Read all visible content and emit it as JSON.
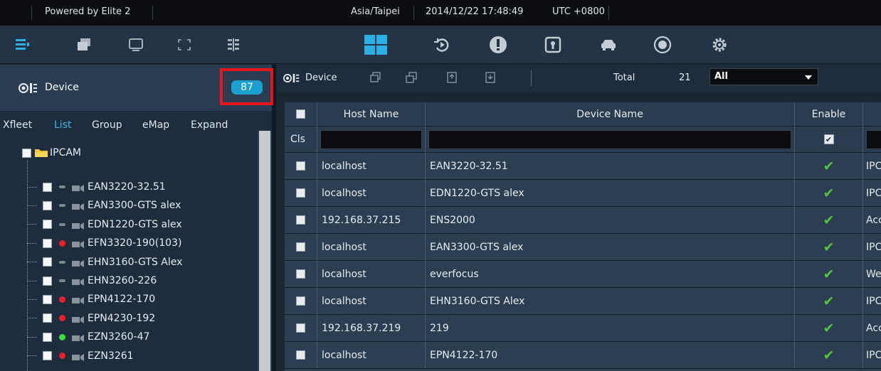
{
  "statusbar": {
    "powered_by": "Powered by Elite 2",
    "timezone": "Asia/Taipei",
    "datetime": "2014/12/22 17:48:49",
    "utc": "UTC +0800"
  },
  "toolbar": {
    "left_icons": [
      "list-panel-icon",
      "windows-icon",
      "monitor-icon",
      "fullscreen-icon",
      "grid-layout-icon"
    ],
    "main_icons": [
      "dashboard-icon",
      "playback-icon",
      "alarm-icon",
      "access-card-icon",
      "vehicle-icon",
      "face-icon",
      "settings-icon"
    ]
  },
  "left_panel": {
    "title": "Device",
    "count": "87",
    "tabs": [
      "Xfleet",
      "List",
      "Group",
      "eMap",
      "Expand"
    ],
    "active_tab": "List",
    "root_label": "IPCAM",
    "items": [
      {
        "label": "EAN3220-32.51",
        "status": "gray"
      },
      {
        "label": "EAN3300-GTS alex",
        "status": "gray"
      },
      {
        "label": "EDN1220-GTS alex",
        "status": "gray"
      },
      {
        "label": "EFN3320-190(103)",
        "status": "red"
      },
      {
        "label": "EHN3160-GTS Alex",
        "status": "gray"
      },
      {
        "label": "EHN3260-226",
        "status": "gray"
      },
      {
        "label": "EPN4122-170",
        "status": "red"
      },
      {
        "label": "EPN4230-192",
        "status": "red"
      },
      {
        "label": "EZN3260-47",
        "status": "green"
      },
      {
        "label": "EZN3261",
        "status": "red"
      }
    ]
  },
  "right_panel": {
    "title": "Device",
    "total_label": "Total",
    "total_value": "21",
    "filter_value": "All",
    "columns": [
      "Host Name",
      "Device Name",
      "Enable"
    ],
    "filter_clear_label": "Cls",
    "rows": [
      {
        "host": "localhost",
        "device": "EAN3220-32.51",
        "extra": "IPC"
      },
      {
        "host": "localhost",
        "device": "EDN1220-GTS alex",
        "extra": "IPC"
      },
      {
        "host": "192.168.37.215",
        "device": "ENS2000",
        "extra": "Acc"
      },
      {
        "host": "localhost",
        "device": "EAN3300-GTS alex",
        "extra": "IPC"
      },
      {
        "host": "localhost",
        "device": "everfocus",
        "extra": "We"
      },
      {
        "host": "localhost",
        "device": "EHN3160-GTS Alex",
        "extra": "IPC"
      },
      {
        "host": "192.168.37.219",
        "device": "219",
        "extra": "Acc"
      },
      {
        "host": "localhost",
        "device": "EPN4122-170",
        "extra": "IPC"
      }
    ]
  },
  "colors": {
    "accent_blue": "#3fb7ea",
    "count_badge": "#1aa1d0",
    "highlight_red": "#e8161c",
    "status_red": "#e8202a",
    "status_green": "#3ddc3d",
    "status_gray": "#7d858d",
    "check_green": "#55c23d"
  }
}
